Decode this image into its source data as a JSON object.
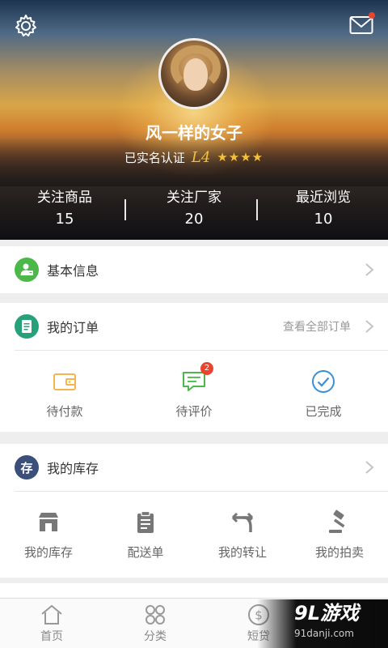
{
  "profile": {
    "name": "风一样的女子",
    "verified_text": "已实名认证",
    "level": "L4",
    "stars": "★★★★"
  },
  "stats": [
    {
      "label": "关注商品",
      "count": "15"
    },
    {
      "label": "关注厂家",
      "count": "20"
    },
    {
      "label": "最近浏览",
      "count": "10"
    }
  ],
  "basic_info": {
    "label": "基本信息"
  },
  "orders": {
    "title": "我的订单",
    "view_all": "查看全部订单",
    "items": [
      {
        "label": "待付款",
        "icon": "wallet-icon",
        "color": "#f5b54a"
      },
      {
        "label": "待评价",
        "icon": "comment-icon",
        "color": "#4cb84a",
        "badge": "2"
      },
      {
        "label": "已完成",
        "icon": "check-circle-icon",
        "color": "#3a8fd9"
      }
    ]
  },
  "inventory": {
    "title": "我的库存",
    "icon_char": "存",
    "items": [
      {
        "label": "我的库存",
        "icon": "store-icon"
      },
      {
        "label": "配送单",
        "icon": "clipboard-icon"
      },
      {
        "label": "我的转让",
        "icon": "transfer-icon"
      },
      {
        "label": "我的拍卖",
        "icon": "gavel-icon"
      }
    ]
  },
  "nav": [
    {
      "label": "首页",
      "icon": "home-icon"
    },
    {
      "label": "分类",
      "icon": "category-icon"
    },
    {
      "label": "短贷",
      "icon": "dollar-icon"
    }
  ],
  "watermark": {
    "top": "9L游戏",
    "bottom": "91danji.com"
  },
  "colors": {
    "accent_green": "#4cb84a",
    "accent_teal": "#27a17a",
    "inventory_badge": "#3a4f7a",
    "star": "#f5c038"
  }
}
